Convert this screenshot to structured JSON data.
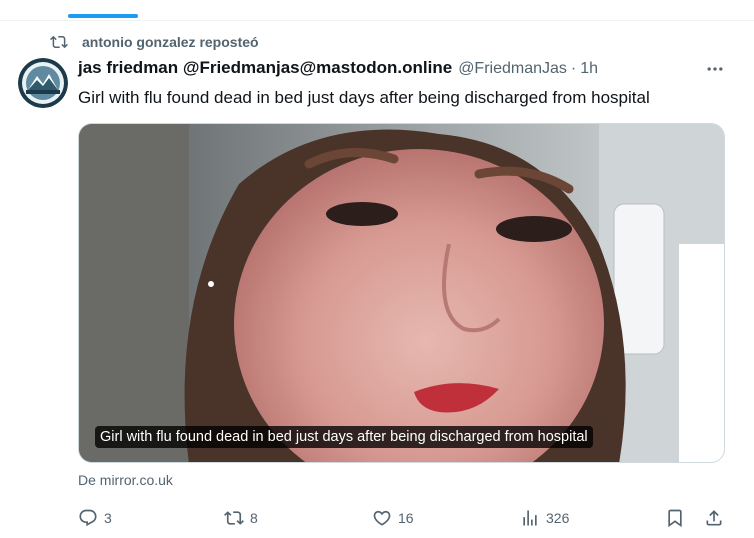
{
  "repost": {
    "icon": "repost-icon",
    "label": "antonio gonzalez reposteó"
  },
  "tweet": {
    "avatar": "avatar",
    "display_name": "jas friedman @Friedmanjas@mastodon.online",
    "handle": "@FriedmanJas",
    "separator": "·",
    "time": "1h",
    "text": "Girl with flu found dead in bed just days after being discharged from hospital",
    "media": {
      "caption": "Girl with flu found dead in bed just days after being discharged from hospital"
    },
    "source": "De mirror.co.uk"
  },
  "actions": {
    "reply": {
      "icon": "reply-icon",
      "count": "3"
    },
    "repost": {
      "icon": "repost-icon",
      "count": "8"
    },
    "like": {
      "icon": "heart-icon",
      "count": "16"
    },
    "views": {
      "icon": "views-chart-icon",
      "count": "326"
    },
    "bookmark": {
      "icon": "bookmark-icon"
    },
    "share": {
      "icon": "share-icon"
    }
  },
  "colors": {
    "accent": "#1d9bf0",
    "secondary_text": "#536471",
    "primary_text": "#0f1419"
  }
}
